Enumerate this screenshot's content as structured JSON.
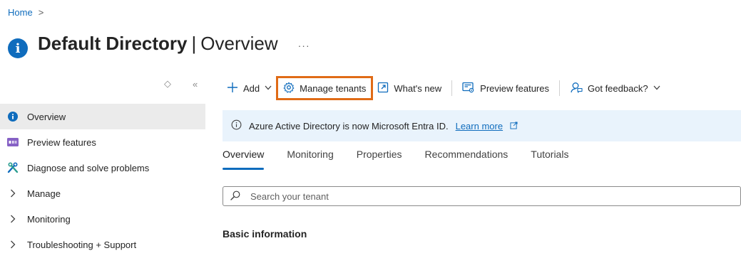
{
  "breadcrumb": {
    "home": "Home",
    "separator": ">"
  },
  "header": {
    "title": "Default Directory",
    "separator": "|",
    "subtitle": "Overview",
    "more": "···"
  },
  "sidebar_controls": {
    "pin": "◇",
    "collapse": "«"
  },
  "sidebar": {
    "items": [
      {
        "label": "Overview",
        "icon": "info-icon",
        "active": true
      },
      {
        "label": "Preview features",
        "icon": "preview-features-icon"
      },
      {
        "label": "Diagnose and solve problems",
        "icon": "wrench-icon"
      },
      {
        "label": "Manage",
        "icon": "chevron-right-icon"
      },
      {
        "label": "Monitoring",
        "icon": "chevron-right-icon"
      },
      {
        "label": "Troubleshooting + Support",
        "icon": "chevron-right-icon"
      }
    ]
  },
  "toolbar": {
    "add": "Add",
    "manage_tenants": "Manage tenants",
    "whats_new": "What's new",
    "preview_features": "Preview features",
    "feedback": "Got feedback?"
  },
  "banner": {
    "text": "Azure Active Directory is now Microsoft Entra ID.",
    "link": "Learn more"
  },
  "tabs": [
    "Overview",
    "Monitoring",
    "Properties",
    "Recommendations",
    "Tutorials"
  ],
  "search": {
    "placeholder": "Search your tenant",
    "value": ""
  },
  "section": {
    "heading": "Basic information"
  },
  "colors": {
    "accent": "#0f6cbd",
    "highlight": "#e06b16",
    "banner_bg": "#e9f3fc",
    "active_bg": "#ebebeb"
  }
}
